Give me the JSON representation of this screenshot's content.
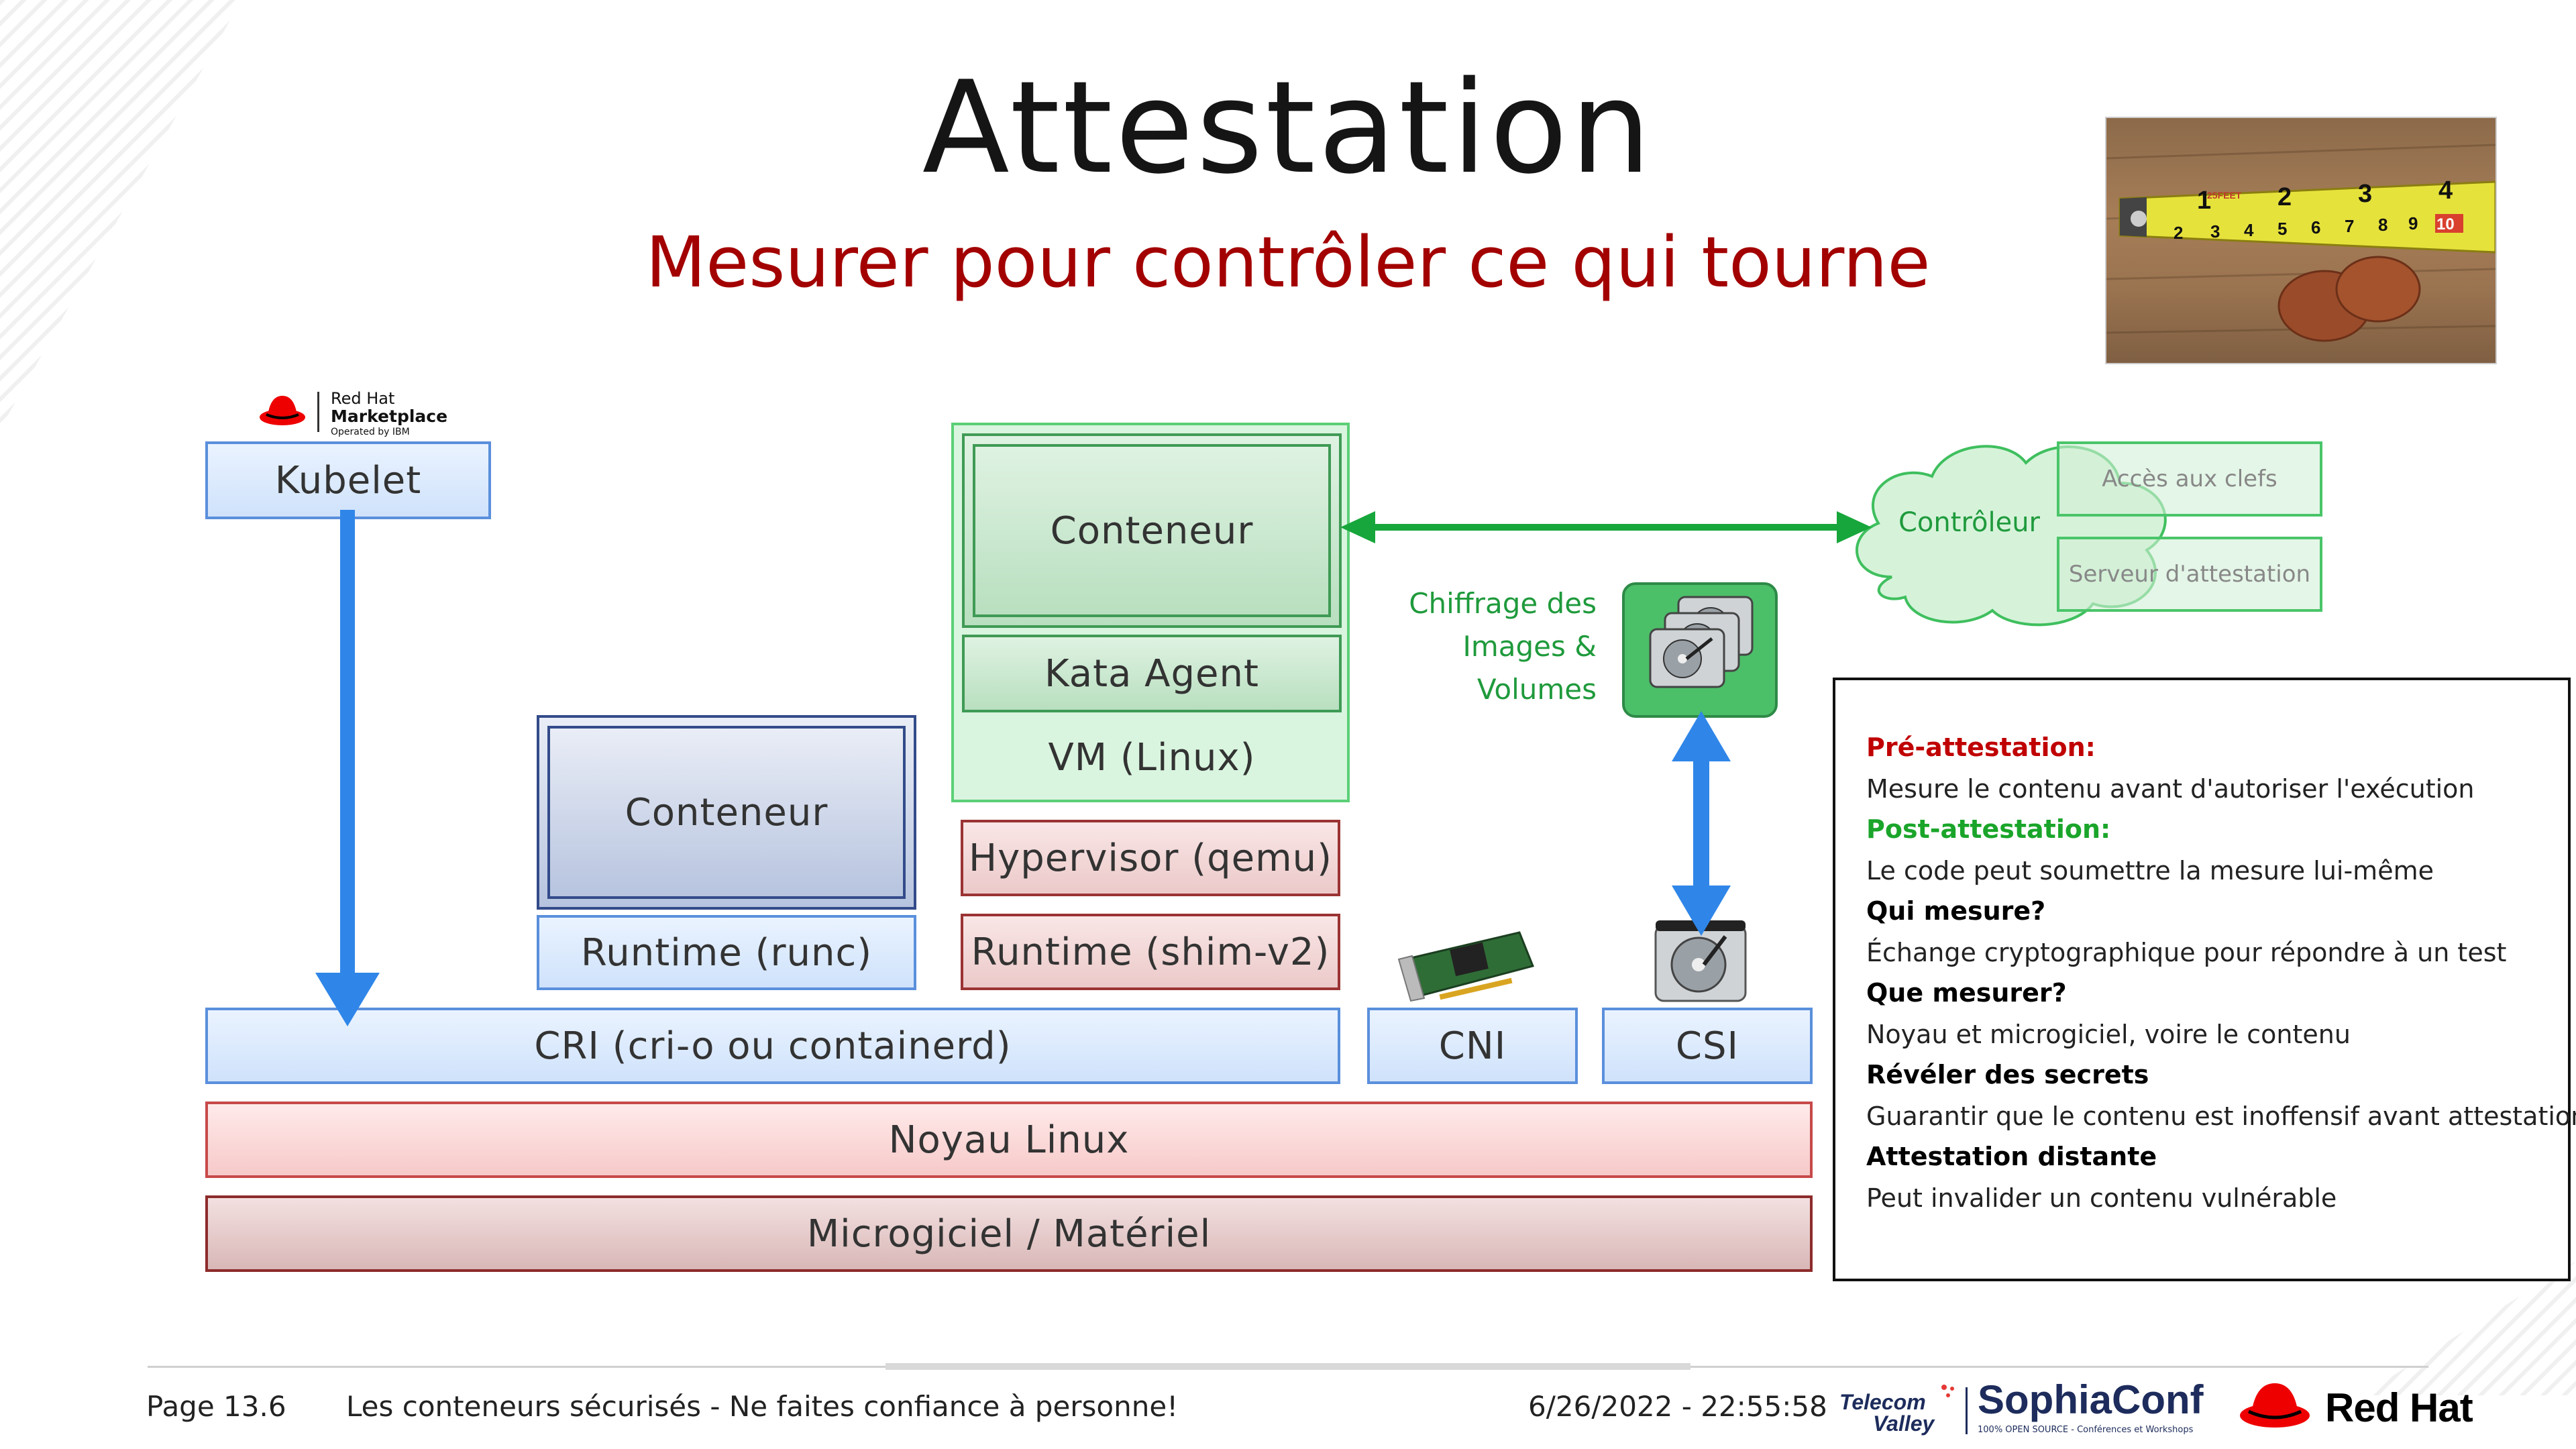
{
  "slide": {
    "title": "Attestation",
    "subtitle": "Mesurer pour contrôler ce qui tourne"
  },
  "marketplace_logo": {
    "line1": "Red Hat",
    "line2": "Marketplace",
    "line3": "Operated by IBM"
  },
  "stack": {
    "kubelet": "Kubelet",
    "runc_container": "Conteneur",
    "runtime_runc": "Runtime (runc)",
    "vm_container": "Conteneur",
    "kata_agent": "Kata Agent",
    "vm_linux": "VM (Linux)",
    "hypervisor": "Hypervisor (qemu)",
    "runtime_shim": "Runtime (shim-v2)",
    "cri": "CRI (cri-o ou containerd)",
    "cni": "CNI",
    "csi": "CSI",
    "kernel": "Noyau Linux",
    "firmware": "Microgiciel / Matériel"
  },
  "encryption_label": [
    "Chiffrage des",
    "Images &",
    "Volumes"
  ],
  "controller": {
    "label": "Contrôleur",
    "items": [
      "Accès aux clefs",
      "Serveur d'attestation"
    ]
  },
  "legend": [
    {
      "heading": "Pré-attestation:",
      "color": "#c00000",
      "text": "Mesure le contenu avant d'autoriser l'exécution"
    },
    {
      "heading": "Post-attestation:",
      "color": "#1aa52a",
      "text": "Le code peut soumettre la mesure lui-même"
    },
    {
      "heading": "Qui mesure?",
      "color": "#000000",
      "text": "Échange cryptographique pour répondre à un test"
    },
    {
      "heading": "Que mesurer?",
      "color": "#000000",
      "text": "Noyau et microgiciel, voire le contenu"
    },
    {
      "heading": "Révéler des secrets",
      "color": "#000000",
      "text": "Guarantir que le contenu est inoffensif avant attestation"
    },
    {
      "heading": "Attestation distante",
      "color": "#000000",
      "text": "Peut invalider un contenu vulnérable"
    }
  ],
  "footer": {
    "page": "Page 13.6",
    "talk": "Les conteneurs sécurisés - Ne faites confiance à personne!",
    "datetime": "6/26/2022 - 22:55:58",
    "telecom_line1": "Telecom",
    "telecom_line2": "Valley",
    "sophia": "SophiaConf",
    "sophia_tag": "100% OPEN SOURCE - Conférences et Workshops",
    "redhat": "Red Hat"
  },
  "photo": {
    "ruler_marks": [
      "1",
      "2",
      "3",
      "4"
    ],
    "ruler_small": [
      "2",
      "3",
      "4",
      "5",
      "6",
      "7",
      "8",
      "9",
      "10"
    ],
    "ruler_text": "25FEET"
  },
  "colors": {
    "accent_red": "#a30000",
    "green_arrow": "#17a63b",
    "blue_arrow": "#2f86e8"
  }
}
